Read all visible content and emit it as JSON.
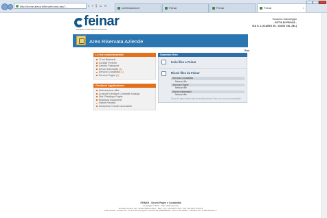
{
  "browser": {
    "address": "http://home.afeca.it/feinar/home.asp?...",
    "address_tools": "⌕ ▾ § ↻ ✕",
    "tabs": [
      {
        "label": "confindustria.it"
      },
      {
        "label": "Feinar"
      },
      {
        "label": "Feinar"
      },
      {
        "label": "Feinar",
        "close": "×"
      }
    ]
  },
  "header": {
    "logo_text": "feinar",
    "logo_tagline": "INTERFACCIA DEI SERVIZI CONFINDE",
    "company_user": "Susanna Salvaleggio",
    "company_name": "- DITTA DI PROVA -",
    "company_address": "VIA S. LUCARDI 35 - 33100 VAL (BL)"
  },
  "banner": {
    "title": "Area Riservata Aziende"
  },
  "esci": "Esci",
  "comunicazioni": {
    "title": "Le tue comunicazioni",
    "items": [
      {
        "label": "I Tuoi Referenti",
        "count": ""
      },
      {
        "label": "Contatti Preferiti",
        "count": ""
      },
      {
        "label": "Cambio Password",
        "count": ""
      },
      {
        "label": "Servizi Informativi",
        "count": "(1)"
      },
      {
        "label": "Servizio Contabilità",
        "count": "(1)"
      },
      {
        "label": "Servizio Paghe",
        "count": "(1)"
      }
    ]
  },
  "gestione": {
    "title": "Gestione Applicazioni",
    "items": [
      {
        "label": "Anticreazione ditta"
      },
      {
        "label": "Cruscotti Gestione Contabile Analogo"
      },
      {
        "label": "Stat. Riepilogo Paghe"
      },
      {
        "label": "Ristampa Documenti"
      },
      {
        "label": "Fatture Vendita"
      },
      {
        "label": "Anteprima Cedolini accessibili"
      }
    ]
  },
  "scambio": {
    "title": "Scambio files",
    "send_label": "Invia files a Feinar",
    "receive_title": "Ricevi files da Feinar",
    "groups": [
      {
        "name": "Servizio Contabilità",
        "sub": "Nessun file"
      },
      {
        "name": "Servizio Paghe",
        "sub": "Nessun file"
      },
      {
        "name": "Servizi Informativi",
        "sub": "Nessun file"
      }
    ],
    "note": "Dopo 40 giorni dalla data di pubblicazione i files non sono più scaricabili"
  },
  "footer": {
    "title": "FEINAR - Servizi Paghe e Contabilità",
    "line1": "Copyright © 2013 - Tutti i diritti riservati",
    "line2": "Via San Lucano, 28 - 32100 Belluno (BL) - Italy - Tel. +39 0437 2721 - Fax +39 0437 272271",
    "line3": "Cod.Fiscale - Partita IVA - N.Iscrizione Registro Imprese BL 0000000000 - R.E.A. BL 00000 - Capitale Soc. € 000.000,00 i.v."
  },
  "colors": {
    "banner": "#2b76b0",
    "orange_header": "#e2701d",
    "blue_header": "#2f6fa6",
    "logo": "#0f4f80"
  }
}
